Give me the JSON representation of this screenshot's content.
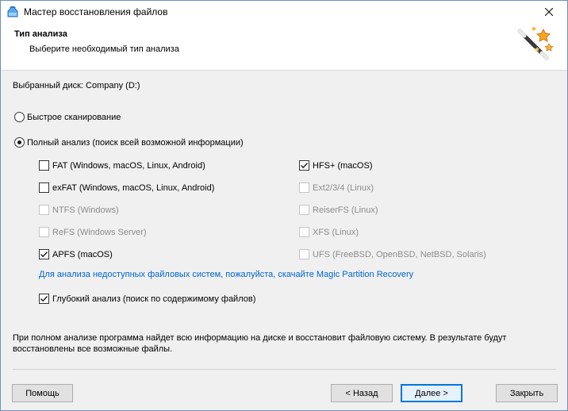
{
  "window": {
    "title": "Мастер восстановления файлов"
  },
  "header": {
    "title": "Тип анализа",
    "subtitle": "Выберите необходимый тип анализа"
  },
  "selected_disk": "Выбранный диск: Company (D:)",
  "scan_options": {
    "quick": {
      "label": "Быстрое сканирование",
      "selected": false
    },
    "full": {
      "label": "Полный анализ (поиск всей возможной информации)",
      "selected": true
    }
  },
  "filesystems": {
    "left": [
      {
        "label": "FAT (Windows, macOS, Linux, Android)",
        "checked": false,
        "enabled": true
      },
      {
        "label": "exFAT (Windows, macOS, Linux, Android)",
        "checked": false,
        "enabled": true
      },
      {
        "label": "NTFS (Windows)",
        "checked": false,
        "enabled": false
      },
      {
        "label": "ReFS (Windows Server)",
        "checked": false,
        "enabled": false
      },
      {
        "label": "APFS (macOS)",
        "checked": true,
        "enabled": true
      }
    ],
    "right": [
      {
        "label": "HFS+ (macOS)",
        "checked": true,
        "enabled": true
      },
      {
        "label": "Ext2/3/4 (Linux)",
        "checked": false,
        "enabled": false
      },
      {
        "label": "ReiserFS (Linux)",
        "checked": false,
        "enabled": false
      },
      {
        "label": "XFS (Linux)",
        "checked": false,
        "enabled": false
      },
      {
        "label": "UFS (FreeBSD, OpenBSD, NetBSD, Solaris)",
        "checked": false,
        "enabled": false
      }
    ]
  },
  "link_text": "Для анализа недоступных файловых систем, пожалуйста, скачайте Magic Partition Recovery",
  "deep_analysis": {
    "label": "Глубокий анализ (поиск по содержимому файлов)",
    "checked": true
  },
  "description": "При полном анализе программа найдет всю информацию на диске и восстановит файловую систему. В результате будут восстановлены все возможные файлы.",
  "buttons": {
    "help": "Помощь",
    "back": "< Назад",
    "next": "Далее >",
    "close": "Закрыть"
  },
  "colors": {
    "link": "#0066cc",
    "accent": "#0078d7"
  }
}
